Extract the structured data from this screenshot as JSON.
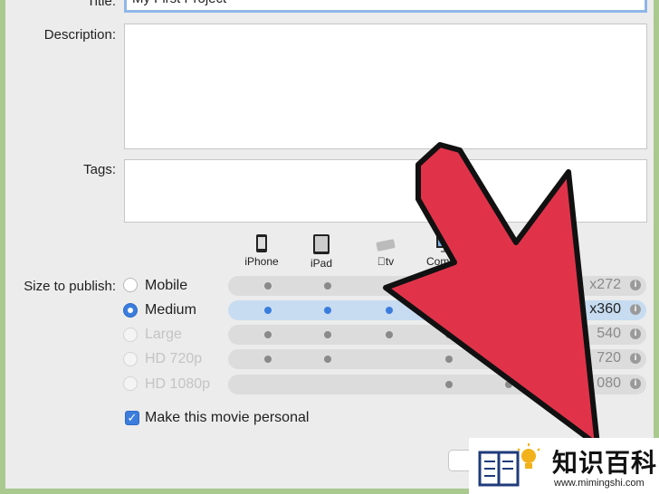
{
  "form": {
    "title_label": "Title:",
    "title_value": "My First Project",
    "description_label": "Description:",
    "tags_label": "Tags:",
    "size_label": "Size to publish:"
  },
  "devices": [
    {
      "name": "iPhone",
      "icon": "iphone-icon"
    },
    {
      "name": "iPad",
      "icon": "ipad-icon"
    },
    {
      "name": "tv",
      "icon": "apple-tv-icon"
    },
    {
      "name": "Comput",
      "icon": "computer-icon"
    }
  ],
  "sizes": [
    {
      "label": "Mobile",
      "dims": "x272"
    },
    {
      "label": "Medium",
      "dims": "x360"
    },
    {
      "label": "Large",
      "dims": "540"
    },
    {
      "label": "HD 720p",
      "dims": "720"
    },
    {
      "label": "HD 1080p",
      "dims": "080"
    }
  ],
  "personal_label": "Make this movie personal",
  "watermark": {
    "text": "知识百科",
    "url": "www.mimingshi.com"
  },
  "colors": {
    "accent": "#3b7ddd",
    "arrow": "#e0334a",
    "frame": "#a9c98f"
  }
}
